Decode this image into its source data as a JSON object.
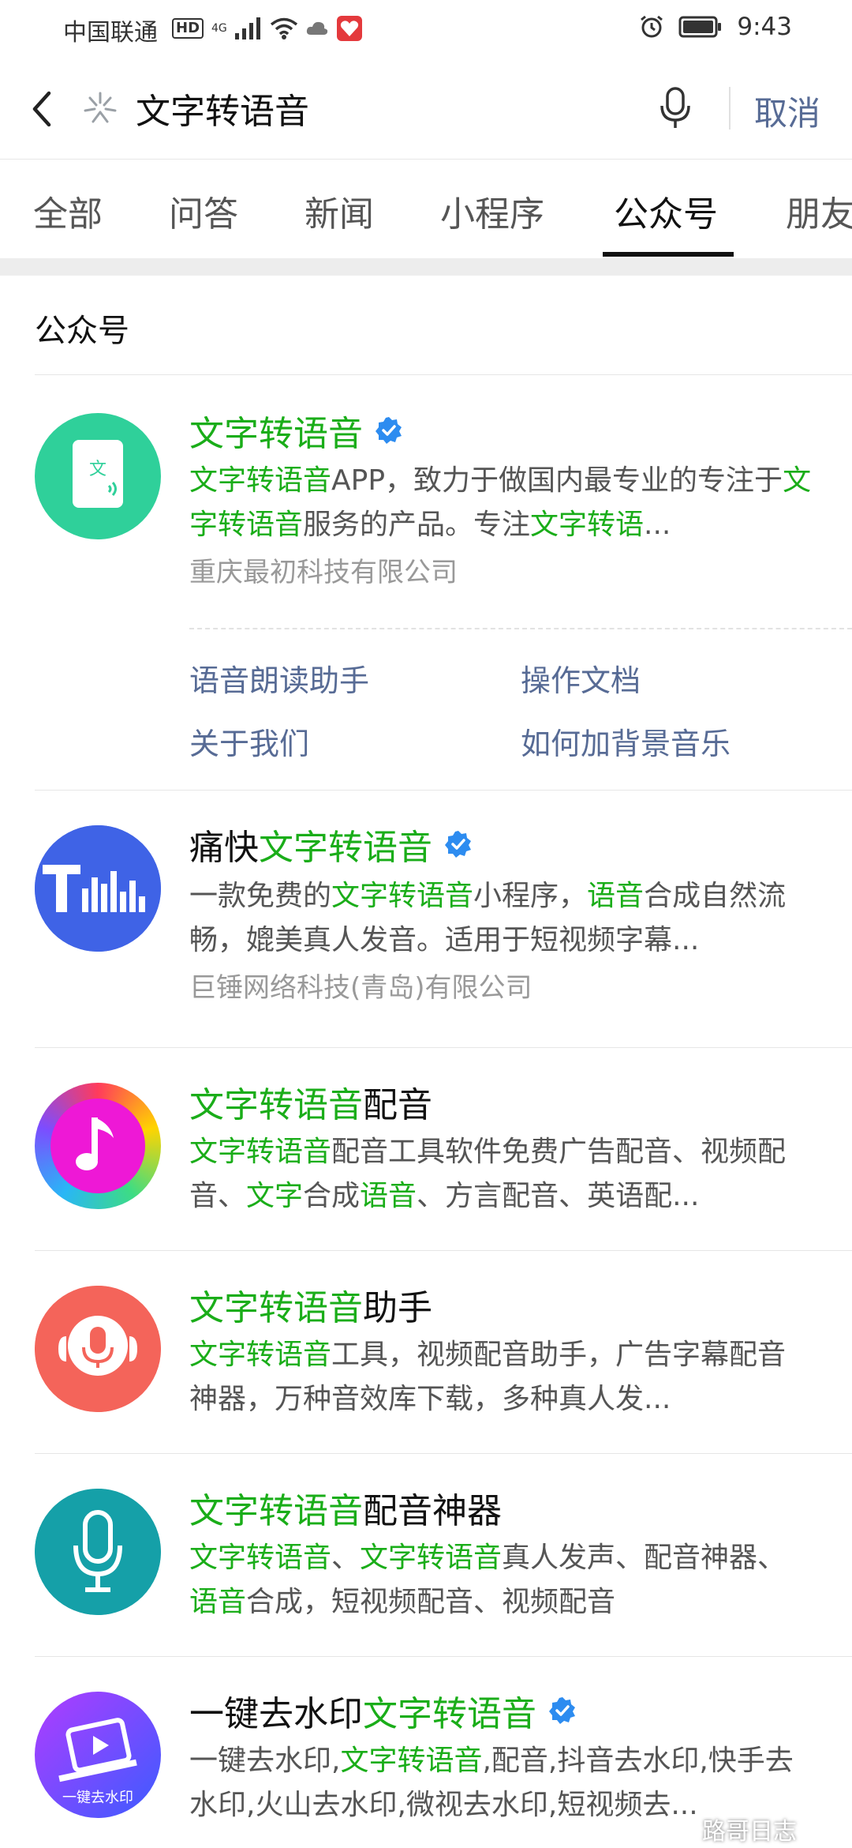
{
  "status_bar": {
    "carrier": "中国联通",
    "hd": "HD",
    "network": "4G",
    "time": "9:43"
  },
  "search": {
    "query": "文字转语音",
    "cancel_label": "取消"
  },
  "tabs": [
    "全部",
    "问答",
    "新闻",
    "小程序",
    "公众号",
    "朋友"
  ],
  "active_tab": "公众号",
  "section_title": "公众号",
  "results": [
    {
      "title_hl": "文字转语音",
      "title_rest": "",
      "verified": true,
      "desc_parts": [
        {
          "hl": true,
          "t": "文字转语音"
        },
        {
          "hl": false,
          "t": "APP，致力于做国内最专业的专注于"
        },
        {
          "hl": true,
          "t": "文字转语音"
        },
        {
          "hl": false,
          "t": "服务的产品。专注"
        },
        {
          "hl": true,
          "t": "文字转语"
        },
        {
          "hl": false,
          "t": "..."
        }
      ],
      "company": "重庆最初科技有限公司",
      "avatar_text": "文",
      "menu": [
        "语音朗读助手",
        "操作文档",
        "关于我们",
        "如何加背景音乐"
      ]
    },
    {
      "title_pre": "痛快",
      "title_hl": "文字转语音",
      "verified": true,
      "desc_parts": [
        {
          "hl": false,
          "t": "一款免费的"
        },
        {
          "hl": true,
          "t": "文字转语音"
        },
        {
          "hl": false,
          "t": "小程序，"
        },
        {
          "hl": true,
          "t": "语音"
        },
        {
          "hl": false,
          "t": "合成自然流畅，媲美真人发音。适用于短视频字幕..."
        }
      ],
      "company": "巨锤网络科技(青岛)有限公司"
    },
    {
      "title_hl": "文字转语音",
      "title_rest": "配音",
      "verified": false,
      "desc_parts": [
        {
          "hl": true,
          "t": "文字转语音"
        },
        {
          "hl": false,
          "t": "配音工具软件免费广告配音、视频配音、"
        },
        {
          "hl": true,
          "t": "文字"
        },
        {
          "hl": false,
          "t": "合成"
        },
        {
          "hl": true,
          "t": "语音"
        },
        {
          "hl": false,
          "t": "、方言配音、英语配..."
        }
      ]
    },
    {
      "title_hl": "文字转语音",
      "title_rest": "助手",
      "verified": false,
      "desc_parts": [
        {
          "hl": true,
          "t": "文字转语音"
        },
        {
          "hl": false,
          "t": "工具，视频配音助手，广告字幕配音神器，万种音效库下载，多种真人发..."
        }
      ]
    },
    {
      "title_hl": "文字转语音",
      "title_rest": "配音神器",
      "verified": false,
      "desc_parts": [
        {
          "hl": true,
          "t": "文字转语音"
        },
        {
          "hl": false,
          "t": "、"
        },
        {
          "hl": true,
          "t": "文字转语音"
        },
        {
          "hl": false,
          "t": "真人发声、配音神器、"
        },
        {
          "hl": true,
          "t": "语音"
        },
        {
          "hl": false,
          "t": "合成，短视频配音、视频配音"
        }
      ]
    },
    {
      "title_pre": "一键去水印",
      "title_hl": "文字转语音",
      "verified": true,
      "desc_parts": [
        {
          "hl": false,
          "t": "一键去水印,"
        },
        {
          "hl": true,
          "t": "文字转语音"
        },
        {
          "hl": false,
          "t": ",配音,抖音去水印,快手去水印,火山去水印,微视去水印,短视频去..."
        }
      ],
      "avatar_text": "一键去水印"
    }
  ],
  "watermark": "路哥日志",
  "colors": {
    "highlight": "#1aad19",
    "link": "#576b95",
    "verified": "#2d8cf0"
  }
}
